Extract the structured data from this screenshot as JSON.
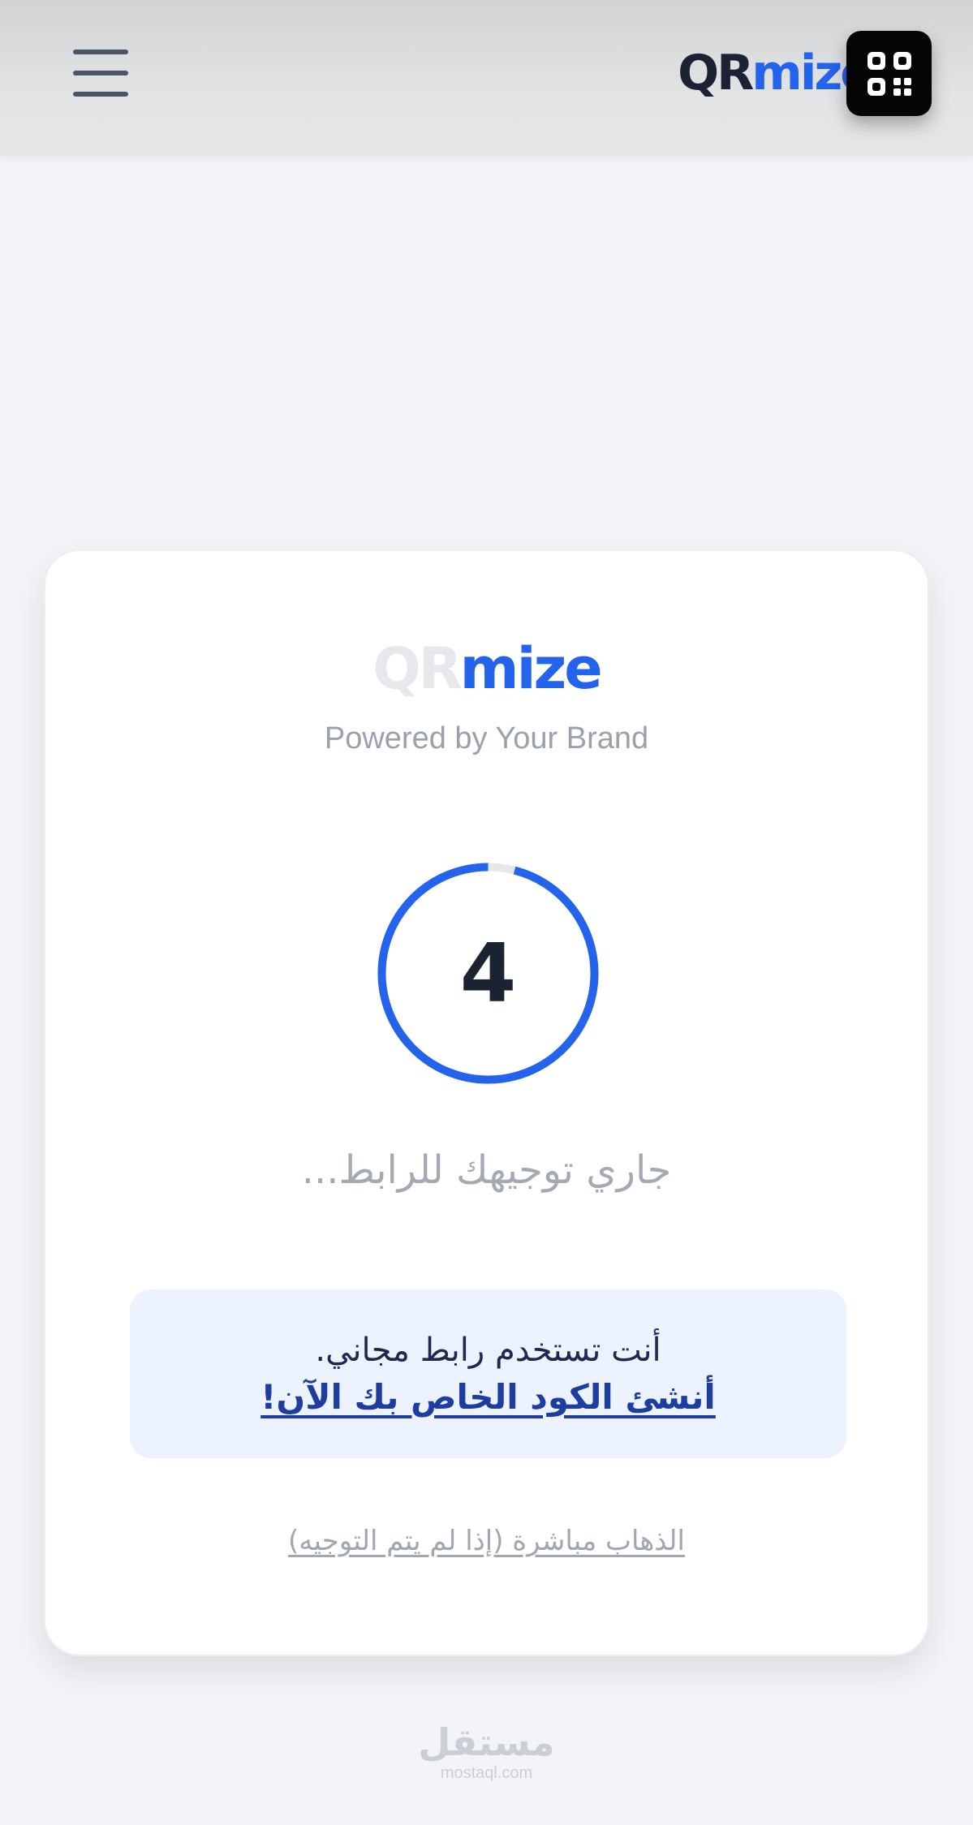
{
  "header": {
    "menu_icon": "hamburger-menu-icon",
    "brand_qr": "QR",
    "brand_mize": "mize",
    "logo_icon": "qr-code-icon"
  },
  "card": {
    "brand_qr": "QR",
    "brand_mize": "mize",
    "tagline": "Powered by Your Brand",
    "countdown": {
      "value": "4",
      "progress_fraction": 0.96
    },
    "status_text": "جاري توجيهك للرابط...",
    "promo": {
      "text": "أنت تستخدم رابط مجاني.",
      "link": "أنشئ الكود الخاص بك الآن!"
    },
    "direct_link": "الذهاب مباشرة (إذا لم يتم التوجيه)"
  },
  "watermark": {
    "arabic": "مستقل",
    "latin": "mostaql.com"
  },
  "colors": {
    "brand_blue": "#2463eb",
    "dark_text": "#1b2232",
    "ring_track": "#e5e7eb",
    "promo_bg": "#ecf3ff"
  }
}
